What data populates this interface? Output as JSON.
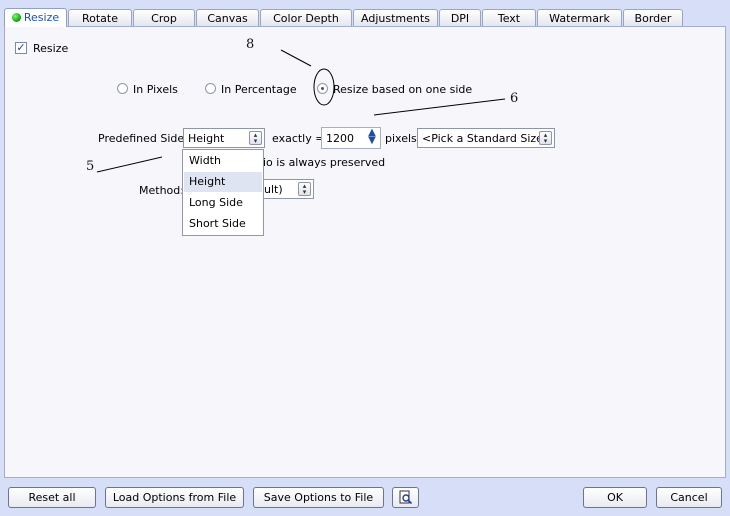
{
  "tabs": [
    {
      "label": "Resize",
      "active": true
    },
    {
      "label": "Rotate"
    },
    {
      "label": "Crop"
    },
    {
      "label": "Canvas"
    },
    {
      "label": "Color Depth"
    },
    {
      "label": "Adjustments"
    },
    {
      "label": "DPI"
    },
    {
      "label": "Text"
    },
    {
      "label": "Watermark"
    },
    {
      "label": "Border"
    }
  ],
  "resize": {
    "checkbox_label": "Resize",
    "checked": true,
    "modes": {
      "pixels": "In Pixels",
      "percentage": "In Percentage",
      "one_side": "Resize based on one side",
      "selected": "one_side"
    },
    "predefined_side_label": "Predefined Side:",
    "predefined_side_value": "Height",
    "exactly_label": "exactly =",
    "pixels_value": "1200",
    "pixels_label": "pixels",
    "standard_size_value": "<Pick a Standard Size>",
    "aspect_note_partial": "io is always preserved",
    "method_label": "Method:",
    "method_value_partial": "ult)",
    "dropdown_options": [
      "Width",
      "Height",
      "Long Side",
      "Short Side"
    ],
    "dropdown_highlighted": "Height"
  },
  "annotations": {
    "a8": "8",
    "a6": "6",
    "a5": "5"
  },
  "footer": {
    "reset_all": "Reset all",
    "load_options": "Load Options from File",
    "save_options": "Save Options to File",
    "preview_icon": "preview-magnifier-icon",
    "ok": "OK",
    "cancel": "Cancel"
  }
}
